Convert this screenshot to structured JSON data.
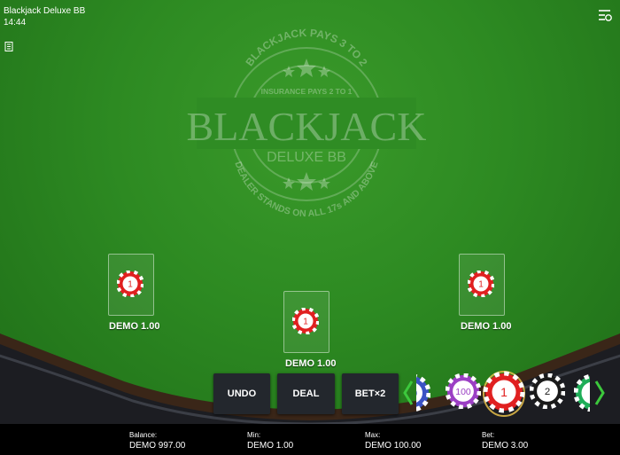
{
  "game": {
    "title": "Blackjack Deluxe BB",
    "time": "14:44"
  },
  "logo": {
    "arc_top": "BLACKJACK PAYS 3 TO 2",
    "insurance": "INSURANCE PAYS 2 TO 1",
    "name": "BLACKJACK",
    "subname": "DELUXE BB",
    "arc_bottom": "DEALER STANDS ON ALL 17s AND ABOVE"
  },
  "bet_spots": [
    {
      "label": "DEMO 1.00",
      "chip_value": "1"
    },
    {
      "label": "DEMO 1.00",
      "chip_value": "1"
    },
    {
      "label": "DEMO 1.00",
      "chip_value": "1"
    }
  ],
  "buttons": {
    "undo": "UNDO",
    "deal": "DEAL",
    "bet_x2": "BET×2"
  },
  "chips": [
    {
      "value": "10",
      "color": "#3b52c4"
    },
    {
      "value": "100",
      "color": "#9b3fc4"
    },
    {
      "value": "1",
      "color": "#e02020",
      "selected": true
    },
    {
      "value": "2",
      "color": "#1a1a1a"
    },
    {
      "value": "1",
      "color": "#1fae58"
    }
  ],
  "footer": {
    "balance_label": "Balance:",
    "balance_value": "DEMO 997.00",
    "min_label": "Min:",
    "min_value": "DEMO 1.00",
    "max_label": "Max:",
    "max_value": "DEMO 100.00",
    "bet_label": "Bet:",
    "bet_value": "DEMO 3.00"
  },
  "colors": {
    "felt": "#2d8a22",
    "rail": "#3a2618",
    "button_bg": "#23272d",
    "chip_highlight": "#f2c94c",
    "arrow": "#3cc83c"
  }
}
